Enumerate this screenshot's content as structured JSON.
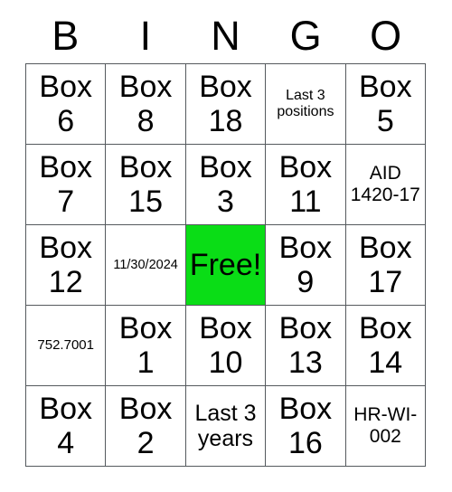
{
  "card": {
    "title": "BINGO",
    "free_space_color": "#0add16",
    "grid_line_color": "#555a5e",
    "background_color": "#ffffff",
    "columns": 5,
    "rows": 5
  },
  "header": {
    "letters": [
      "B",
      "I",
      "N",
      "G",
      "O"
    ]
  },
  "grid": {
    "rows": [
      {
        "cells": [
          {
            "text": "Box 6",
            "size": "xl",
            "free": false
          },
          {
            "text": "Box 8",
            "size": "xl",
            "free": false
          },
          {
            "text": "Box 18",
            "size": "xl",
            "free": false
          },
          {
            "text": "Last 3 positions",
            "size": "sm",
            "free": false
          },
          {
            "text": "Box 5",
            "size": "xl",
            "free": false
          }
        ]
      },
      {
        "cells": [
          {
            "text": "Box 7",
            "size": "xl",
            "free": false
          },
          {
            "text": "Box 15",
            "size": "xl",
            "free": false
          },
          {
            "text": "Box 3",
            "size": "xl",
            "free": false
          },
          {
            "text": "Box 11",
            "size": "xl",
            "free": false
          },
          {
            "text": "AID 1420-17",
            "size": "md",
            "free": false
          }
        ]
      },
      {
        "cells": [
          {
            "text": "Box 12",
            "size": "xl",
            "free": false
          },
          {
            "text": "11/30/2024",
            "size": "xxs",
            "free": false
          },
          {
            "text": "Free!",
            "size": "xl",
            "free": true
          },
          {
            "text": "Box 9",
            "size": "xl",
            "free": false
          },
          {
            "text": "Box 17",
            "size": "xl",
            "free": false
          }
        ]
      },
      {
        "cells": [
          {
            "text": "752.7001",
            "size": "xs",
            "free": false
          },
          {
            "text": "Box 1",
            "size": "xl",
            "free": false
          },
          {
            "text": "Box 10",
            "size": "xl",
            "free": false
          },
          {
            "text": "Box 13",
            "size": "xl",
            "free": false
          },
          {
            "text": "Box 14",
            "size": "xl",
            "free": false
          }
        ]
      },
      {
        "cells": [
          {
            "text": "Box 4",
            "size": "xl",
            "free": false
          },
          {
            "text": "Box 2",
            "size": "xl",
            "free": false
          },
          {
            "text": "Last 3 years",
            "size": "lg",
            "free": false
          },
          {
            "text": "Box 16",
            "size": "xl",
            "free": false
          },
          {
            "text": "HR-WI-002",
            "size": "md",
            "free": false
          }
        ]
      }
    ]
  }
}
